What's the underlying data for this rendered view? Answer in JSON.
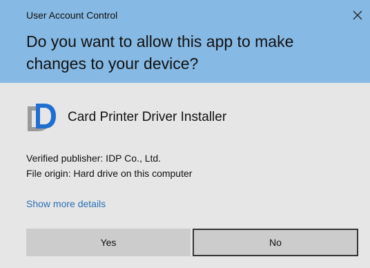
{
  "window": {
    "title": "User Account Control",
    "close_icon": "close-icon"
  },
  "prompt": {
    "question": "Do you want to allow this app to make changes to your device?"
  },
  "app": {
    "icon": "app-logo-icon",
    "name": "Card Printer Driver Installer"
  },
  "details": {
    "publisher": "Verified publisher: IDP Co., Ltd.",
    "origin": "File origin: Hard drive on this computer"
  },
  "links": {
    "show_more": "Show more details"
  },
  "buttons": {
    "yes": "Yes",
    "no": "No"
  },
  "colors": {
    "header_bg": "#86b9e3",
    "body_bg": "#e6e6e6",
    "link": "#2b6fb5",
    "button_bg": "#cccccc",
    "focus_border": "#333333"
  }
}
